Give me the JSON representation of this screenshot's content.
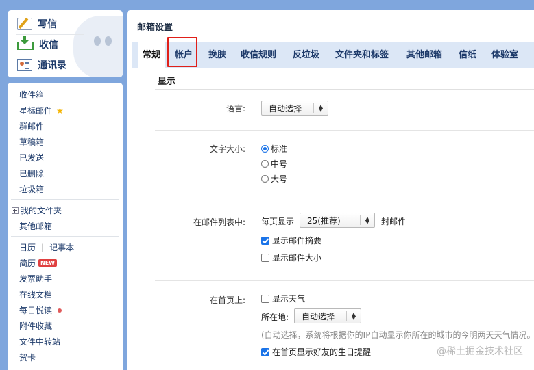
{
  "toolbar": {
    "write": "写信",
    "receive": "收信",
    "contacts": "通讯录"
  },
  "nav": {
    "inbox": "收件箱",
    "starred": "星标邮件",
    "group": "群邮件",
    "drafts": "草稿箱",
    "sent": "已发送",
    "deleted": "已删除",
    "spam": "垃圾箱",
    "my_folders": "我的文件夹",
    "other_mailboxes": "其他邮箱",
    "calendar": "日历",
    "separator": "|",
    "notes": "记事本",
    "resume": "简历",
    "new_badge": "NEW",
    "invoice": "发票助手",
    "online_docs": "在线文档",
    "daily_read": "每日悦读",
    "attachments": "附件收藏",
    "file_transfer": "文件中转站",
    "cards": "贺卡"
  },
  "main": {
    "title": "邮箱设置",
    "tabs": [
      "常规",
      "帐户",
      "换肤",
      "收信规则",
      "反垃圾",
      "文件夹和标签",
      "其他邮箱",
      "信纸",
      "体验室"
    ],
    "active_tab": "常规"
  },
  "settings": {
    "section_title": "显示",
    "language_label": "语言:",
    "language_value": "自动选择",
    "font_size_label": "文字大小:",
    "font_sizes": [
      "标准",
      "中号",
      "大号"
    ],
    "font_size_selected": "标准",
    "list_label": "在邮件列表中:",
    "per_page_prefix": "每页显示",
    "per_page_value": "25(推荐)",
    "per_page_suffix": "封邮件",
    "show_summary": "显示邮件摘要",
    "show_summary_checked": true,
    "show_size": "显示邮件大小",
    "show_size_checked": false,
    "homepage_label": "在首页上:",
    "show_weather": "显示天气",
    "show_weather_checked": false,
    "location_label": "所在地:",
    "location_value": "自动选择",
    "location_note": "(自动选择，系统将根据你的IP自动显示你所在的城市的今明两天天气情况。",
    "show_birthday": "在首页显示好友的生日提醒",
    "show_birthday_checked": true
  },
  "watermark": "@稀土掘金技术社区",
  "colors": {
    "background": "#7fa6dd",
    "tabbar": "#dce7f6",
    "highlight": "#e0201a",
    "accent": "#1a73e8"
  }
}
